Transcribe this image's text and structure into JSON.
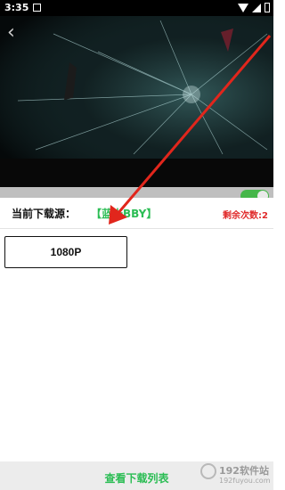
{
  "status_bar": {
    "time": "3:35"
  },
  "source": {
    "title": "当前下载源：",
    "name": "【蓝光BBY】",
    "remaining": "剩余次数:2"
  },
  "quality_options": [
    "1080P"
  ],
  "download_list_label": "查看下载列表",
  "watermark": {
    "text": "192软件站",
    "sub": "192fuyou.com"
  },
  "colors": {
    "accent": "#2bbd54",
    "alert": "#e02a2a",
    "arrow": "#e1261c"
  }
}
